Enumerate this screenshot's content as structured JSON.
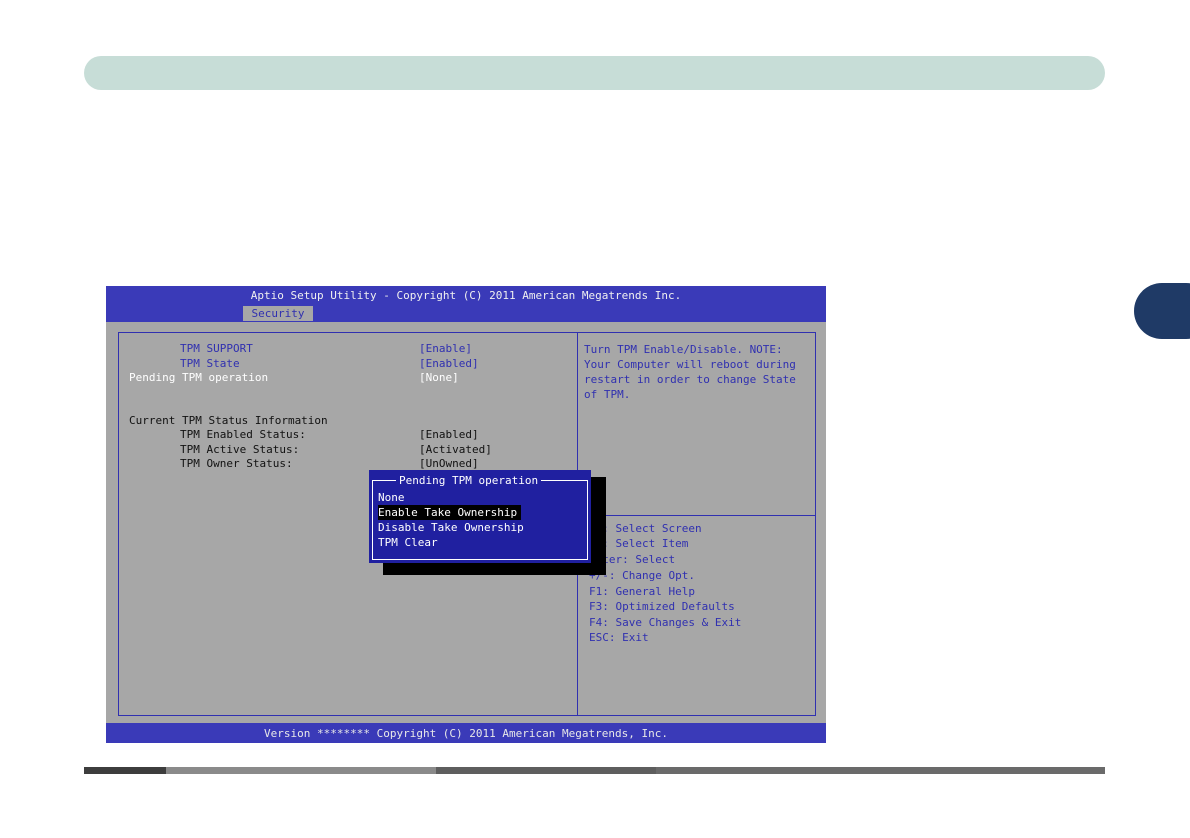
{
  "bios": {
    "title": "Aptio Setup Utility - Copyright (C) 2011 American Megatrends Inc.",
    "active_tab": "Security",
    "settings": [
      {
        "label": "TPM SUPPORT",
        "value": "[Enable]"
      },
      {
        "label": "TPM State",
        "value": "[Enabled]"
      },
      {
        "label": "Pending TPM operation",
        "value": "[None]"
      }
    ],
    "status_heading": "Current TPM Status Information",
    "status": [
      {
        "label": "TPM Enabled Status:",
        "value": "[Enabled]"
      },
      {
        "label": "TPM Active Status:",
        "value": "[Activated]"
      },
      {
        "label": "TPM Owner Status:",
        "value": "[UnOwned]"
      }
    ],
    "help_text": "Turn TPM Enable/Disable. NOTE: Your Computer will reboot during restart in order to change State of TPM.",
    "keys": [
      "←→: Select Screen",
      "↑↓: Select Item",
      "Enter: Select",
      "+/-: Change Opt.",
      "F1: General Help",
      "F3: Optimized Defaults",
      "F4: Save Changes & Exit",
      "ESC: Exit"
    ],
    "version": "Version ******** Copyright (C) 2011 American Megatrends, Inc."
  },
  "popup": {
    "title": "Pending TPM operation",
    "options": [
      "None",
      "Enable Take Ownership",
      "Disable Take Ownership",
      "TPM Clear"
    ],
    "selected_index": 1
  },
  "colors": {
    "bios_bar": "#3a3ab8",
    "bios_bg": "#a7a7a7",
    "popup_bg": "#2020a0",
    "header_bar": "#c7ddd7",
    "side_tab": "#1f3a66"
  }
}
